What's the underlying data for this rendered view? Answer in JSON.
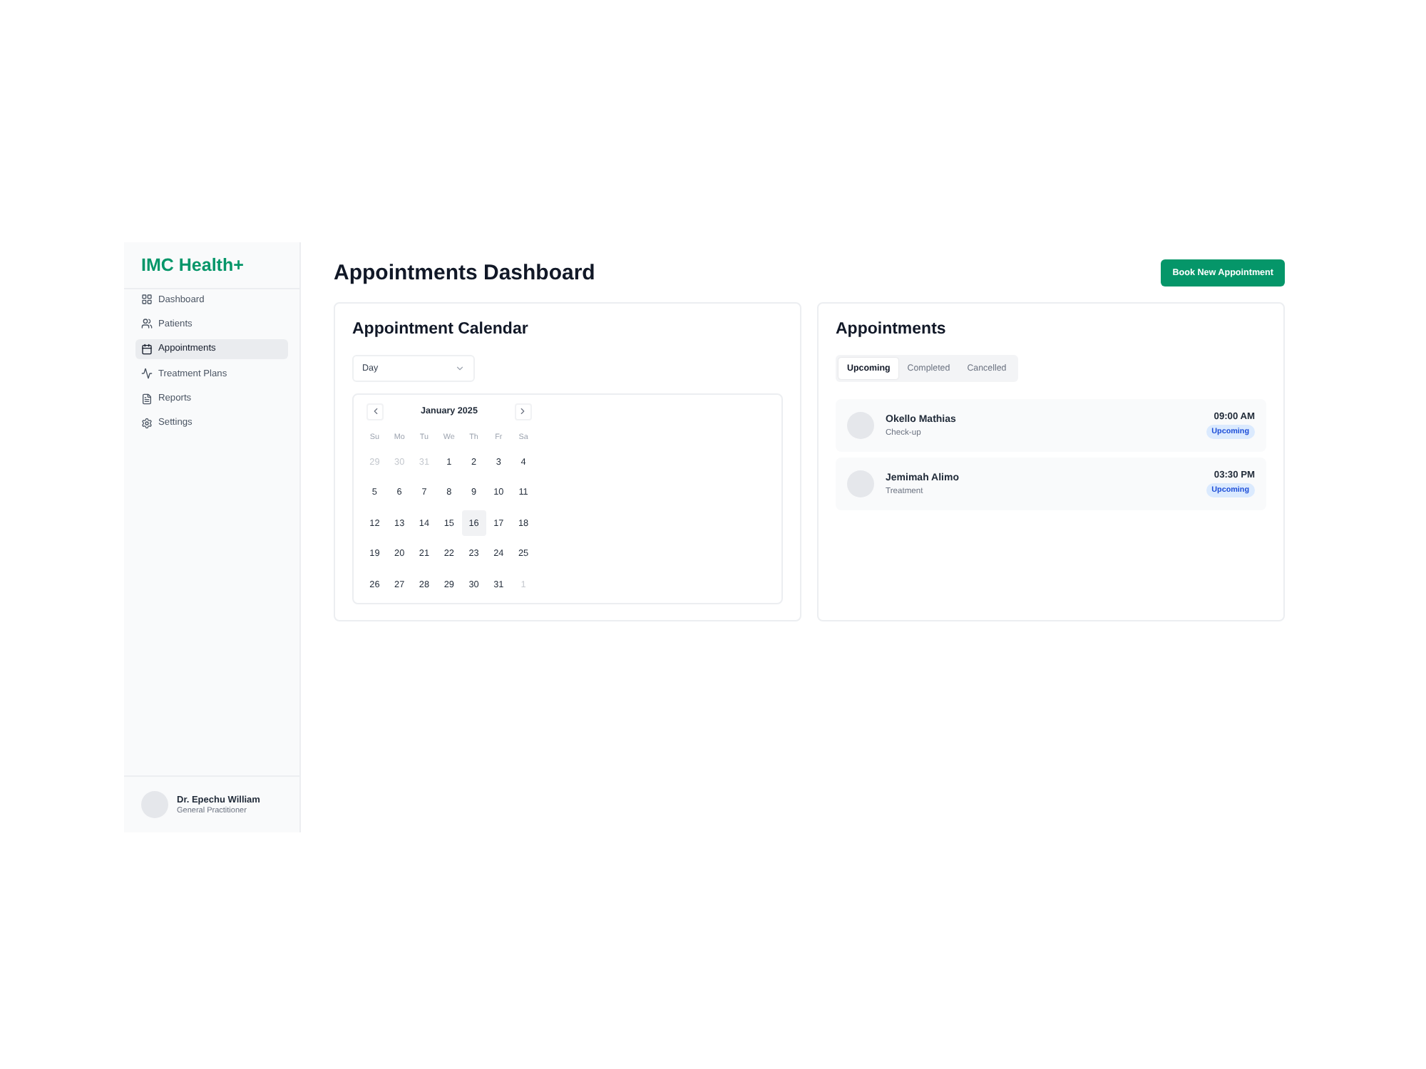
{
  "sidebar": {
    "logo": "IMC Health+",
    "items": [
      {
        "label": "Dashboard",
        "selected": false
      },
      {
        "label": "Patients",
        "selected": false
      },
      {
        "label": "Appointments",
        "selected": true
      },
      {
        "label": "Treatment Plans",
        "selected": false
      },
      {
        "label": "Reports",
        "selected": false
      },
      {
        "label": "Settings",
        "selected": false
      }
    ],
    "user": {
      "name": "Dr. Epechu William",
      "role": "General Practitioner"
    }
  },
  "header": {
    "title": "Appointments Dashboard",
    "button": "Book New Appointment"
  },
  "calendar_card": {
    "title": "Appointment Calendar",
    "view_select": {
      "value": "Day"
    },
    "month": "January 2025",
    "weekdays": [
      "Su",
      "Mo",
      "Tu",
      "We",
      "Th",
      "Fr",
      "Sa"
    ],
    "weeks": [
      {
        "days": [
          {
            "label": "29",
            "outside": true,
            "selected": false
          },
          {
            "label": "30",
            "outside": true,
            "selected": false
          },
          {
            "label": "31",
            "outside": true,
            "selected": false
          },
          {
            "label": "1",
            "outside": false,
            "selected": false
          },
          {
            "label": "2",
            "outside": false,
            "selected": false
          },
          {
            "label": "3",
            "outside": false,
            "selected": false
          },
          {
            "label": "4",
            "outside": false,
            "selected": false
          }
        ]
      },
      {
        "days": [
          {
            "label": "5",
            "outside": false,
            "selected": false
          },
          {
            "label": "6",
            "outside": false,
            "selected": false
          },
          {
            "label": "7",
            "outside": false,
            "selected": false
          },
          {
            "label": "8",
            "outside": false,
            "selected": false
          },
          {
            "label": "9",
            "outside": false,
            "selected": false
          },
          {
            "label": "10",
            "outside": false,
            "selected": false
          },
          {
            "label": "11",
            "outside": false,
            "selected": false
          }
        ]
      },
      {
        "days": [
          {
            "label": "12",
            "outside": false,
            "selected": false
          },
          {
            "label": "13",
            "outside": false,
            "selected": false
          },
          {
            "label": "14",
            "outside": false,
            "selected": false
          },
          {
            "label": "15",
            "outside": false,
            "selected": false
          },
          {
            "label": "16",
            "outside": false,
            "selected": true
          },
          {
            "label": "17",
            "outside": false,
            "selected": false
          },
          {
            "label": "18",
            "outside": false,
            "selected": false
          }
        ]
      },
      {
        "days": [
          {
            "label": "19",
            "outside": false,
            "selected": false
          },
          {
            "label": "20",
            "outside": false,
            "selected": false
          },
          {
            "label": "21",
            "outside": false,
            "selected": false
          },
          {
            "label": "22",
            "outside": false,
            "selected": false
          },
          {
            "label": "23",
            "outside": false,
            "selected": false
          },
          {
            "label": "24",
            "outside": false,
            "selected": false
          },
          {
            "label": "25",
            "outside": false,
            "selected": false
          }
        ]
      },
      {
        "days": [
          {
            "label": "26",
            "outside": false,
            "selected": false
          },
          {
            "label": "27",
            "outside": false,
            "selected": false
          },
          {
            "label": "28",
            "outside": false,
            "selected": false
          },
          {
            "label": "29",
            "outside": false,
            "selected": false
          },
          {
            "label": "30",
            "outside": false,
            "selected": false
          },
          {
            "label": "31",
            "outside": false,
            "selected": false
          },
          {
            "label": "1",
            "outside": true,
            "selected": false
          }
        ]
      }
    ]
  },
  "appointments_card": {
    "title": "Appointments",
    "tabs": [
      {
        "label": "Upcoming",
        "selected": true
      },
      {
        "label": "Completed",
        "selected": false
      },
      {
        "label": "Cancelled",
        "selected": false
      }
    ],
    "items": [
      {
        "name": "Okello Mathias",
        "type": "Check-up",
        "time": "09:00 AM",
        "status": "Upcoming"
      },
      {
        "name": "Jemimah Alimo",
        "type": "Treatment",
        "time": "03:30 PM",
        "status": "Upcoming"
      }
    ]
  }
}
